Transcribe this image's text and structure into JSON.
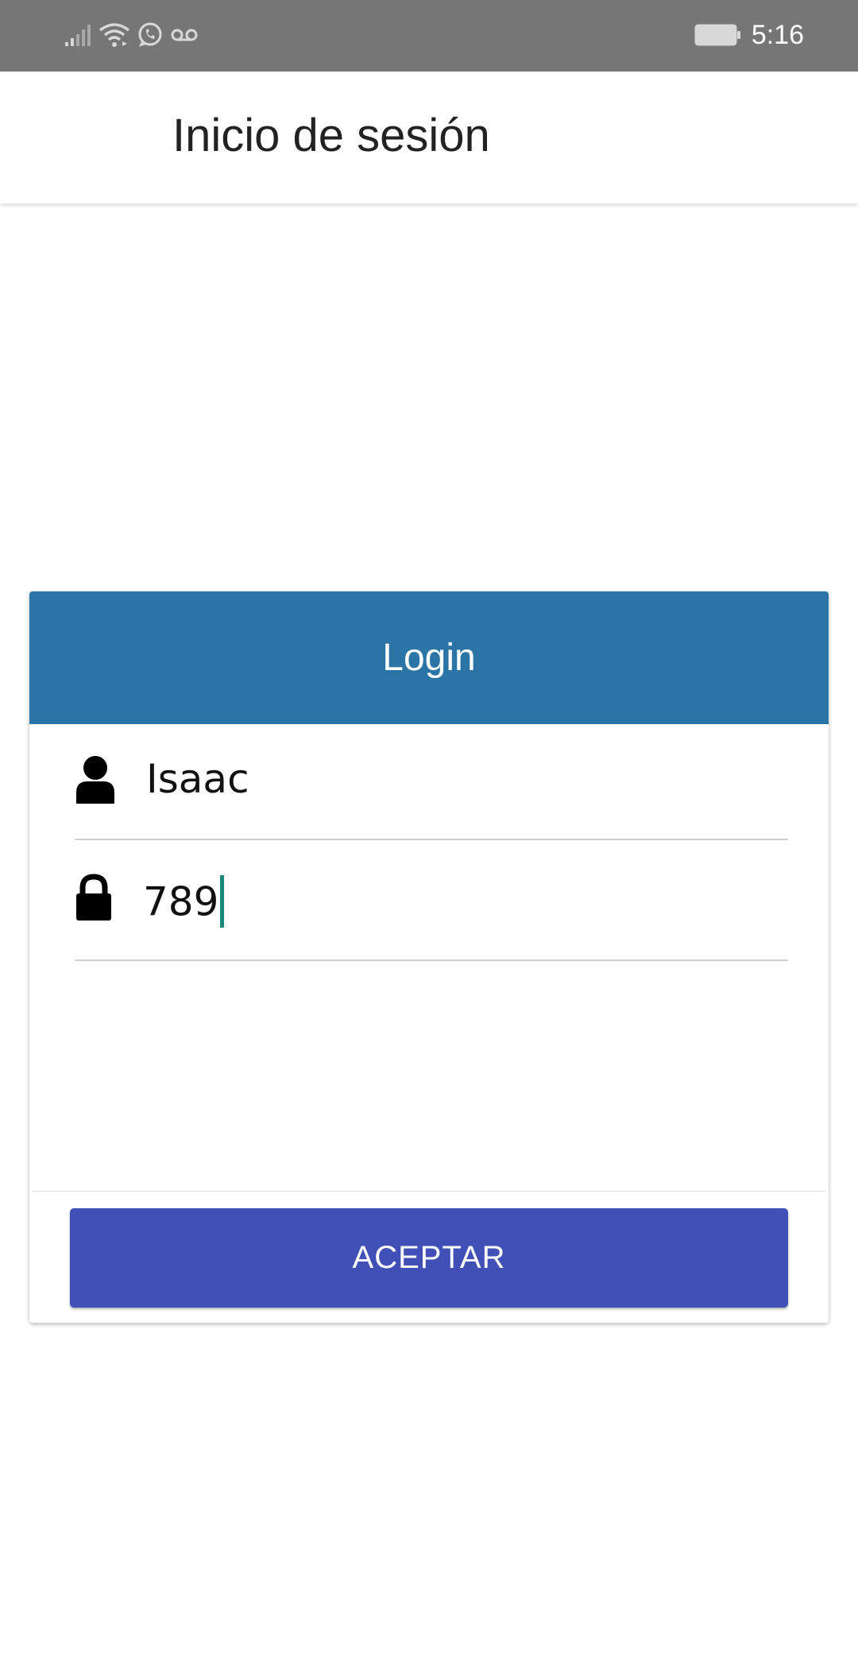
{
  "status_bar": {
    "time": "5:16",
    "icons": [
      "signal-icon",
      "wifi-icon",
      "whatsapp-icon",
      "voicemail-icon",
      "battery-icon"
    ]
  },
  "app_bar": {
    "title": "Inicio de sesión"
  },
  "login_card": {
    "header": "Login",
    "username": {
      "icon": "user-icon",
      "value": "Isaac"
    },
    "password": {
      "icon": "lock-icon",
      "value": "789"
    },
    "accept_label": "ACEPTAR"
  },
  "colors": {
    "status_bar": "#767676",
    "card_header": "#2b75a6",
    "accept_button": "#4150b6",
    "caret": "#1a8a7a"
  }
}
